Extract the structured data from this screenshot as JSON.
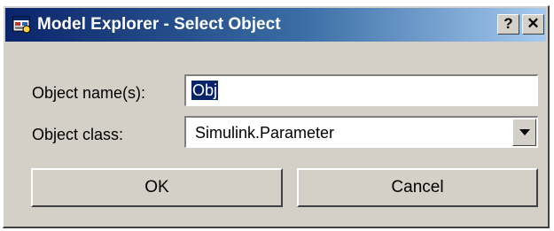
{
  "window": {
    "title": "Model Explorer - Select Object",
    "icon": "model-explorer-icon",
    "help_label": "?",
    "close_label": "✕"
  },
  "form": {
    "name_label": "Object name(s):",
    "name_value": "Obj",
    "class_label": "Object class:",
    "class_value": "Simulink.Parameter"
  },
  "buttons": {
    "ok_label": "OK",
    "cancel_label": "Cancel"
  },
  "colors": {
    "titlebar_start": "#0a246a",
    "titlebar_end": "#a6caf0",
    "dialog_face": "#d4d0c8",
    "selection": "#0a246a"
  }
}
